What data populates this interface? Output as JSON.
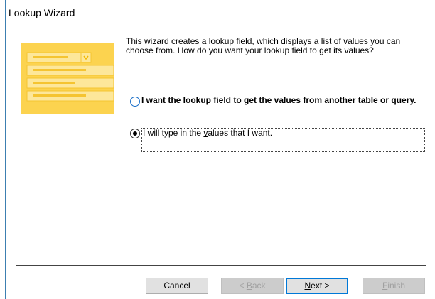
{
  "window": {
    "title": "Lookup Wizard"
  },
  "description": "This wizard creates a lookup field, which displays a list of values you can choose from.  How do you want your lookup field to get its values?",
  "options": [
    {
      "pre": "I want the lookup field to get the values from another ",
      "accel": "t",
      "post": "able or query.",
      "selected": false
    },
    {
      "pre": "I will type in the ",
      "accel": "v",
      "post": "alues that I want.",
      "selected": true
    }
  ],
  "buttons": {
    "cancel": "Cancel",
    "back": {
      "pre": "< ",
      "accel": "B",
      "post": "ack"
    },
    "next": {
      "accel": "N",
      "post": "ext >"
    },
    "finish": {
      "accel": "F",
      "post": "inish"
    }
  },
  "colors": {
    "accent": "#0078d7",
    "illustration": "#fcd34f",
    "illustration_light": "#fde79a"
  }
}
